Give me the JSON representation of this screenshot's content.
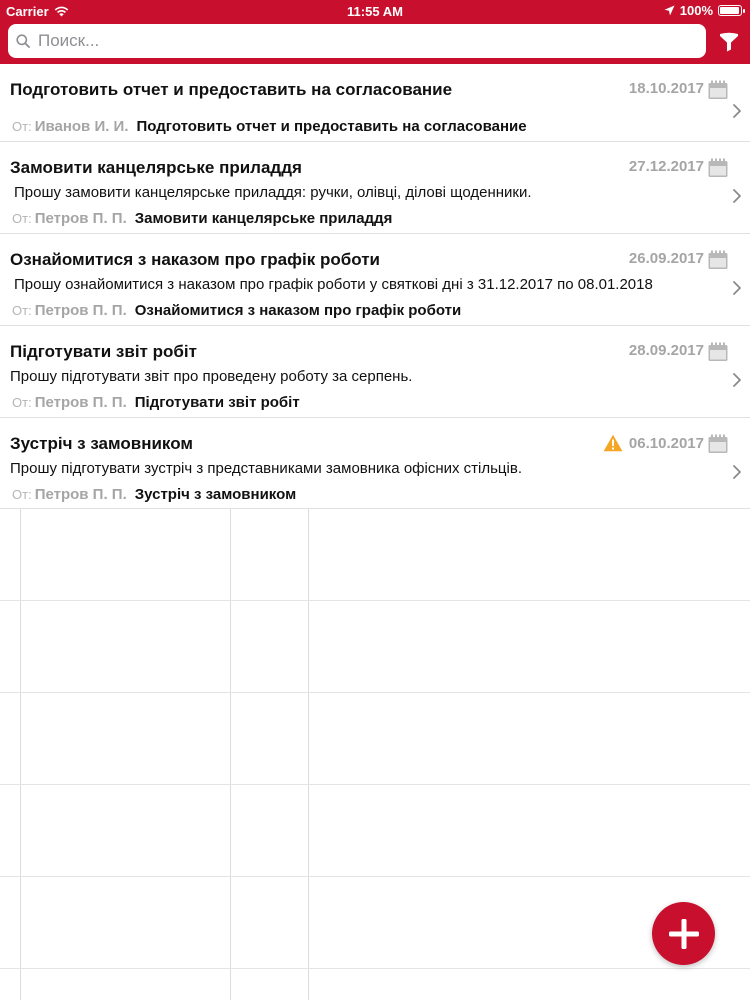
{
  "status_bar": {
    "carrier": "Carrier",
    "time": "11:55 AM",
    "battery": "100%",
    "battery_level": 1.0
  },
  "search": {
    "placeholder": "Поиск..."
  },
  "colors": {
    "brand": "#c8102e",
    "date_gray": "#a5a5a5",
    "warning": "#f5a623"
  },
  "tasks": [
    {
      "title": "Подготовить отчет и предоставить на согласование",
      "date": "18.10.2017",
      "body": "",
      "from_label": "От:",
      "from_name": "Иванов И. И.",
      "subject": "Подготовить отчет и предоставить на согласование",
      "warning": false
    },
    {
      "title": "Замовити канцелярське приладдя",
      "date": "27.12.2017",
      "body": "Прошу замовити канцелярське приладдя: ручки, олівці, ділові щоденники.",
      "from_label": "От:",
      "from_name": "Петров П. П.",
      "subject": "Замовити канцелярське приладдя",
      "warning": false
    },
    {
      "title": "Ознайомитися з наказом про графік роботи",
      "date": "26.09.2017",
      "body": "Прошу ознайомитися з наказом про графік роботи у святкові дні з 31.12.2017 по 08.01.2018",
      "from_label": "От:",
      "from_name": "Петров П. П.",
      "subject": "Ознайомитися з наказом про графік роботи",
      "warning": false
    },
    {
      "title": "Підготувати звіт робіт",
      "date": "28.09.2017",
      "body": "Прошу підготувати звіт про проведену роботу за серпень.",
      "from_label": "От:",
      "from_name": "Петров П. П.",
      "subject": "Підготувати звіт робіт",
      "warning": false
    },
    {
      "title": "Зустріч з замовником",
      "date": "06.10.2017",
      "body": "Прошу підготувати зустріч з представниками замовника офісних стільців.",
      "from_label": "От:",
      "from_name": "Петров П. П.",
      "subject": "Зустріч з замовником",
      "warning": true
    }
  ],
  "icons": {
    "search": "search-icon",
    "filter": "filter-icon",
    "calendar": "calendar-icon",
    "chevron": "chevron-right-icon",
    "warning": "warning-icon",
    "add": "plus-icon"
  }
}
